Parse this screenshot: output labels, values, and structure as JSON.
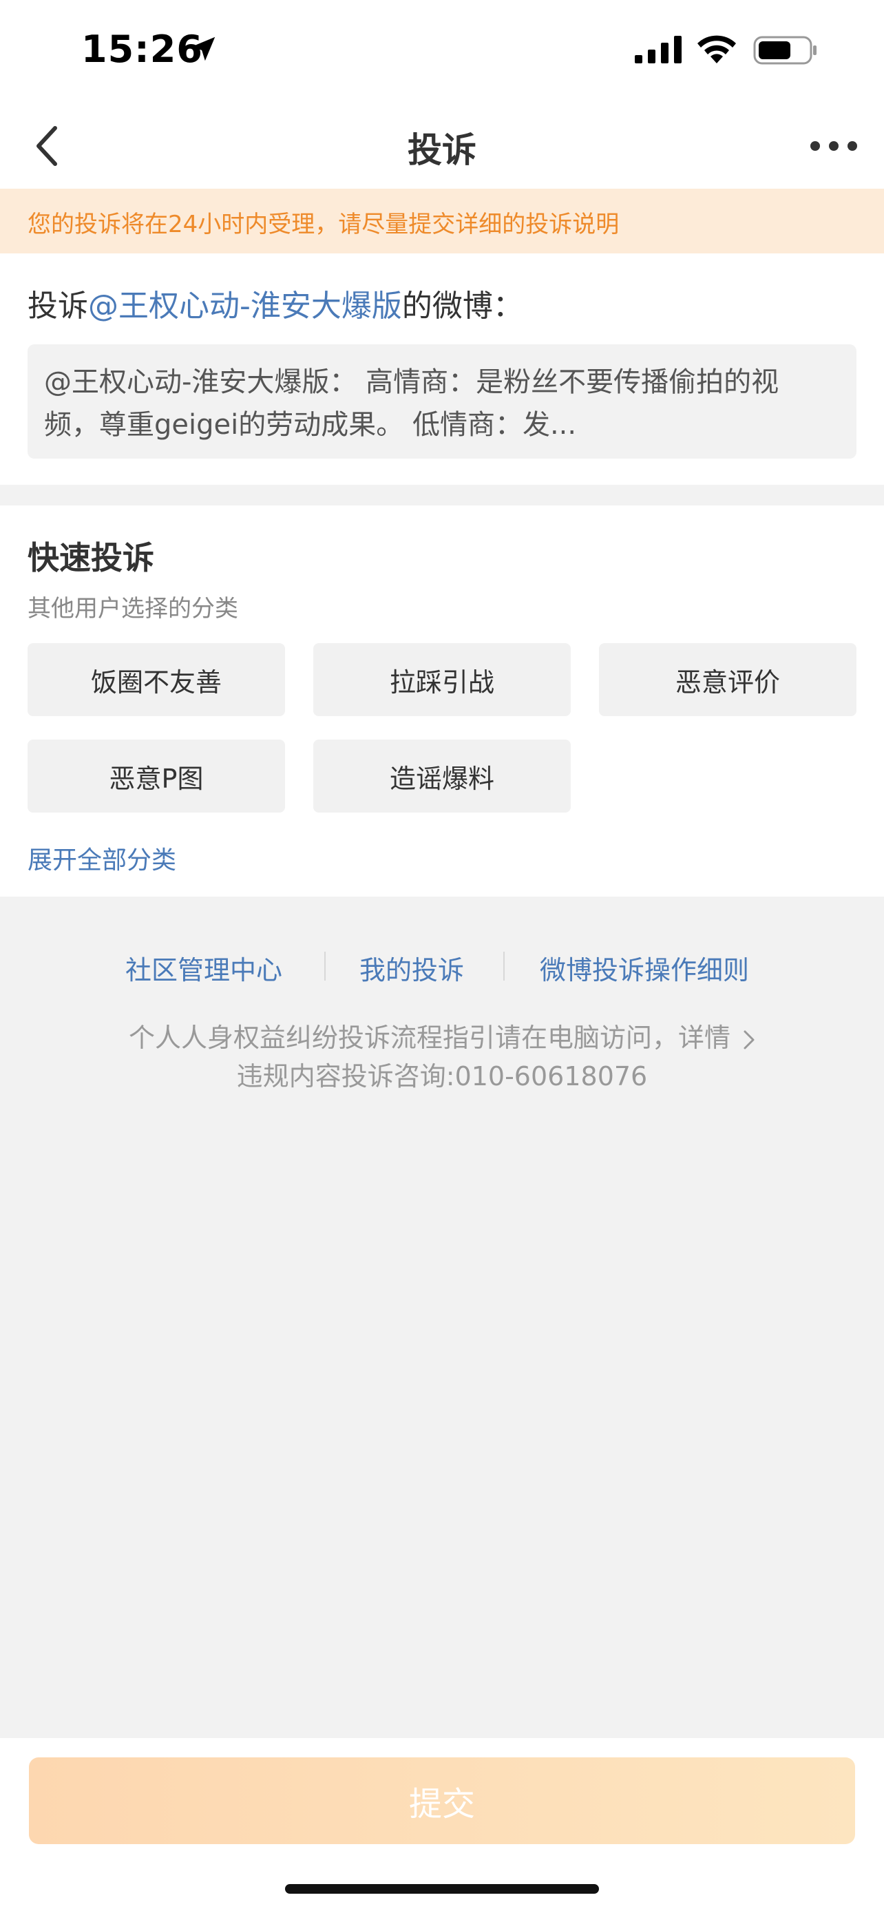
{
  "status_bar": {
    "time": "15:26",
    "icons": [
      "location-arrow-icon",
      "signal-icon",
      "wifi-icon",
      "battery-icon"
    ]
  },
  "nav": {
    "title": "投诉",
    "back_icon": "chevron-left-icon",
    "more_icon": "more-dots-icon"
  },
  "notice": {
    "text": "您的投诉将在24小时内受理，请尽量提交详细的投诉说明"
  },
  "target": {
    "prefix": "投诉",
    "user": "@王权心动-淮安大爆版",
    "suffix": "的微博：",
    "quote": "@王权心动-淮安大爆版：  高情商：是粉丝不要传播偷拍的视\n频，尊重geigei的劳动成果。 低情商：发..."
  },
  "quick": {
    "title": "快速投诉",
    "subtitle": "其他用户选择的分类",
    "chips": [
      "饭圈不友善",
      "拉踩引战",
      "恶意评价",
      "恶意P图",
      "造谣爆料"
    ],
    "expand_label": "展开全部分类"
  },
  "footer": {
    "links": [
      "社区管理中心",
      "我的投诉",
      "微博投诉操作细则"
    ],
    "info_line1": "个人人身权益纠纷投诉流程指引请在电脑访问，详情",
    "info_line2": "违规内容投诉咨询:010-60618076"
  },
  "submit_label": "提交",
  "colors": {
    "accent_blue": "#4a7ab8",
    "notice_text": "#ee8a2a",
    "notice_bg": "#fdebd8",
    "submit_gradient_start": "#fdd7b0",
    "submit_gradient_end": "#fde5c0"
  }
}
